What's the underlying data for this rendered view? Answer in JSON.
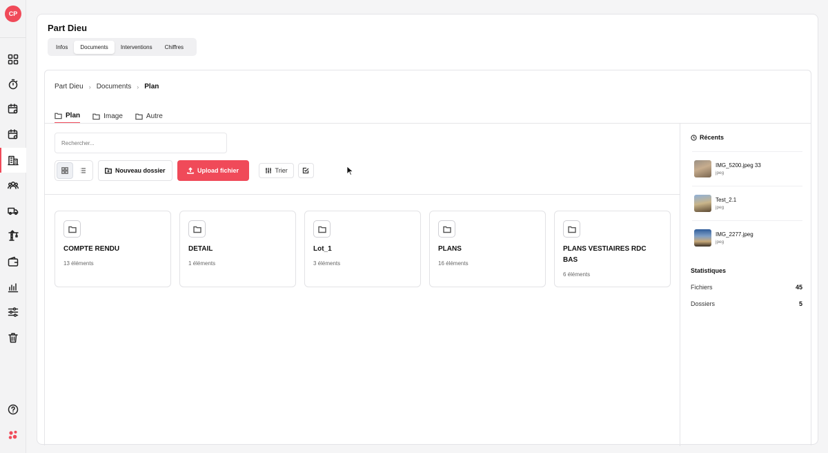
{
  "user": {
    "initials": "CP"
  },
  "page": {
    "title": "Part Dieu"
  },
  "top_tabs": [
    {
      "label": "Infos"
    },
    {
      "label": "Documents",
      "active": true
    },
    {
      "label": "Interventions"
    },
    {
      "label": "Chiffres"
    }
  ],
  "breadcrumb": [
    {
      "label": "Part Dieu"
    },
    {
      "label": "Documents"
    },
    {
      "label": "Plan"
    }
  ],
  "folder_tabs": [
    {
      "label": "Plan",
      "active": true
    },
    {
      "label": "Image"
    },
    {
      "label": "Autre"
    }
  ],
  "search": {
    "placeholder": "Rechercher..."
  },
  "toolbar": {
    "new_folder_label": "Nouveau dossier",
    "upload_label": "Upload fichier",
    "sort_label": "Trier"
  },
  "folders": [
    {
      "name": "COMPTE RENDU",
      "count": "13 éléments"
    },
    {
      "name": "DETAIL",
      "count": "1 éléments"
    },
    {
      "name": "Lot_1",
      "count": "3 éléments"
    },
    {
      "name": "PLANS",
      "count": "16 éléments"
    },
    {
      "name": "PLANS VESTIAIRES RDC BAS",
      "count": "6 éléments"
    }
  ],
  "recents": {
    "title": "Récents",
    "items": [
      {
        "name": "IMG_5200.jpeg 33",
        "type": "jpeg"
      },
      {
        "name": "Test_2.1",
        "type": "jpeg"
      },
      {
        "name": "IMG_2277.jpeg",
        "type": "jpeg"
      }
    ]
  },
  "statistics": {
    "title": "Statistiques",
    "rows": [
      {
        "label": "Fichiers",
        "value": "45"
      },
      {
        "label": "Dossiers",
        "value": "5"
      }
    ]
  },
  "colors": {
    "accent": "#f04a59"
  },
  "sidebar_icons": [
    "dashboard-icon",
    "timer-icon",
    "calendar-settings-icon",
    "calendar-check-icon",
    "building-icon",
    "team-icon",
    "truck-icon",
    "crane-icon",
    "wallet-icon",
    "bar-chart-icon",
    "sliders-icon",
    "trash-icon",
    "help-icon",
    "brand-logo-icon"
  ]
}
